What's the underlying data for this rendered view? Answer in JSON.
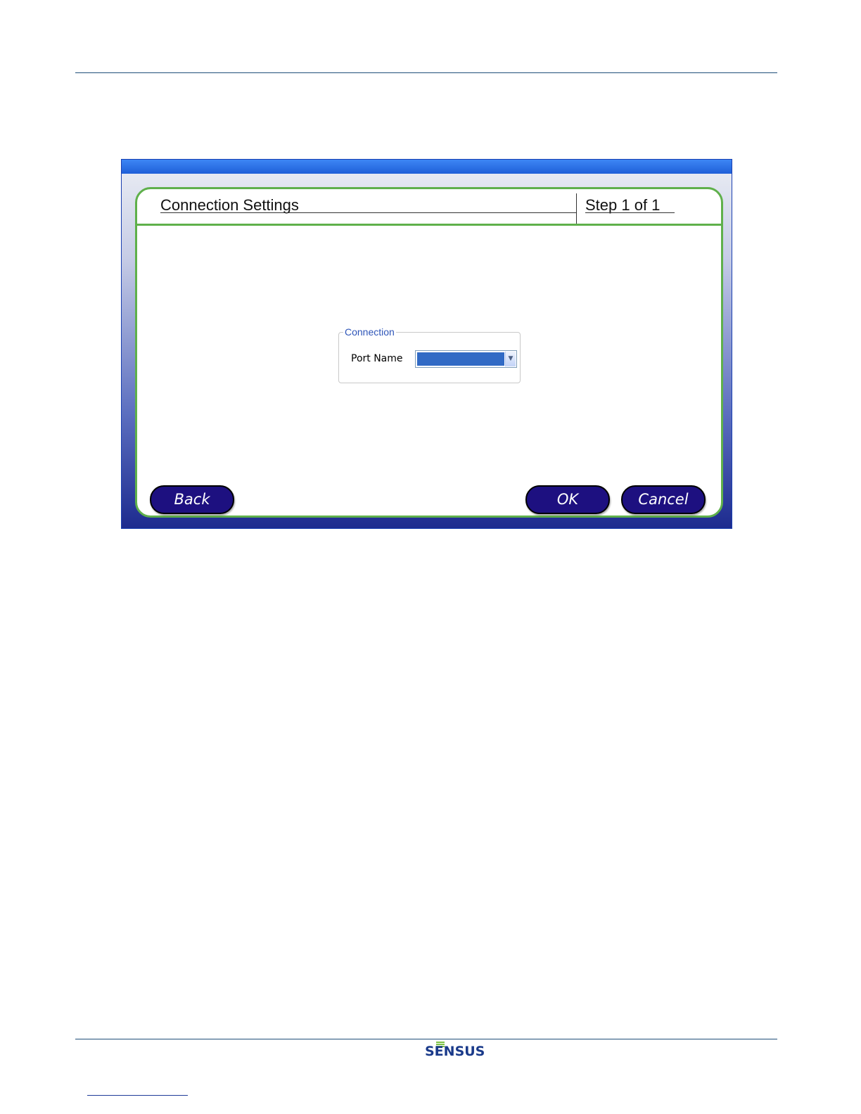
{
  "window": {
    "title": "Connection Settings",
    "step": "Step 1 of 1"
  },
  "connection": {
    "group_label": "Connection",
    "port_label": "Port Name",
    "port_value": ""
  },
  "buttons": {
    "back": "Back",
    "ok": "OK",
    "cancel": "Cancel"
  },
  "footer": {
    "logo": "SENSUS"
  },
  "colors": {
    "panel_border": "#5fb04b",
    "button_fill": "#1d1080",
    "selection": "#316ac5",
    "title_bar": "#2a6de0"
  }
}
